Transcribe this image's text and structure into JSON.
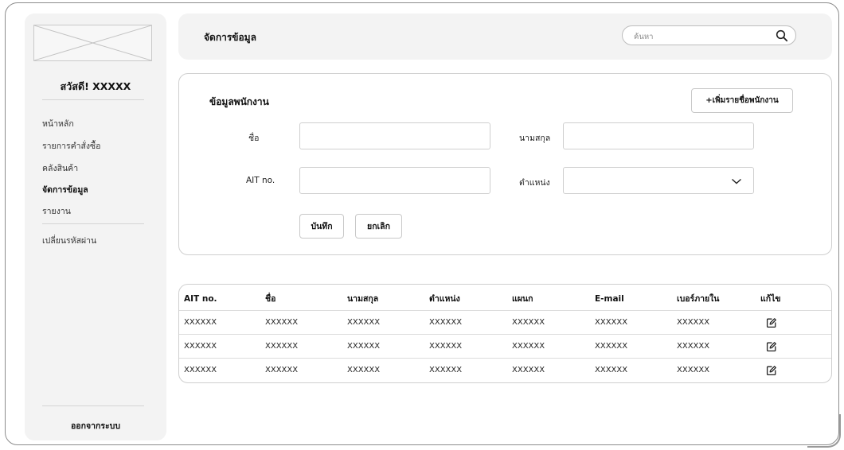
{
  "sidebar": {
    "greeting": "สวัสดี! XXXXX",
    "nav": [
      {
        "label": "หน้าหลัก",
        "active": false
      },
      {
        "label": "รายการคำสั่งซื้อ",
        "active": false
      },
      {
        "label": "คลังสินค้า",
        "active": false
      },
      {
        "label": "จัดการข้อมูล",
        "active": true
      },
      {
        "label": "รายงาน",
        "active": false
      }
    ],
    "change_password": "เปลี่ยนรหัสผ่าน",
    "logout": "ออกจากระบบ"
  },
  "topbar": {
    "title": "จัดการข้อมูล",
    "search_placeholder": "ค้นหา"
  },
  "form": {
    "title": "ข้อมูลพนักงาน",
    "add_button": "+เพิ่มรายชื่อพนักงาน",
    "first_name_label": "ชื่อ",
    "last_name_label": "นามสกุล",
    "ait_label": "AIT no.",
    "position_label": "ตำแหน่ง",
    "save_button": "บันทึก",
    "cancel_button": "ยกเลิก"
  },
  "table": {
    "headers": [
      "AIT no.",
      "ชื่อ",
      "นามสกุล",
      "ตำแหน่ง",
      "แผนก",
      "E-mail",
      "เบอร์ภายใน",
      "แก้ไข"
    ],
    "rows": [
      [
        "XXXXXX",
        "XXXXXX",
        "XXXXXX",
        "XXXXXX",
        "XXXXXX",
        "XXXXXX",
        "XXXXXX"
      ],
      [
        "XXXXXX",
        "XXXXXX",
        "XXXXXX",
        "XXXXXX",
        "XXXXXX",
        "XXXXXX",
        "XXXXXX"
      ],
      [
        "XXXXXX",
        "XXXXXX",
        "XXXXXX",
        "XXXXXX",
        "XXXXXX",
        "XXXXXX",
        "XXXXXX"
      ]
    ]
  },
  "icons": {
    "search": "search-icon",
    "edit": "edit-icon",
    "dropdown": "chevron-down-icon",
    "logo": "logo-placeholder"
  }
}
